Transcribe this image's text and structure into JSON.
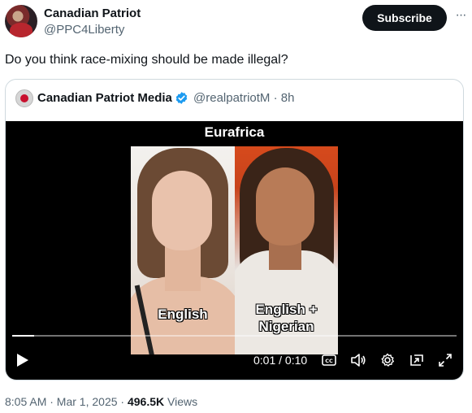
{
  "author": {
    "display_name": "Canadian Patriot",
    "handle": "@PPC4Liberty"
  },
  "subscribe_label": "Subscribe",
  "more_label": "···",
  "tweet_text": "Do you think race-mixing should be made illegal?",
  "quote": {
    "display_name": "Canadian Patriot Media",
    "handle_time": "@realpatriotM · 8h",
    "video": {
      "title": "Eurafrica",
      "caption_left": "English",
      "caption_right_line1": "English +",
      "caption_right_line2": "Nigerian",
      "time": "0:01 / 0:10",
      "progress": 0.05
    }
  },
  "footer": {
    "time_date": "8:05 AM · Mar 1, 2025 · ",
    "views_count": "496.5K",
    "views_label": " Views"
  },
  "colors": {
    "verified": "#1d9bf0",
    "subscribe_bg": "#0f1419",
    "secondary_text": "#536471"
  }
}
